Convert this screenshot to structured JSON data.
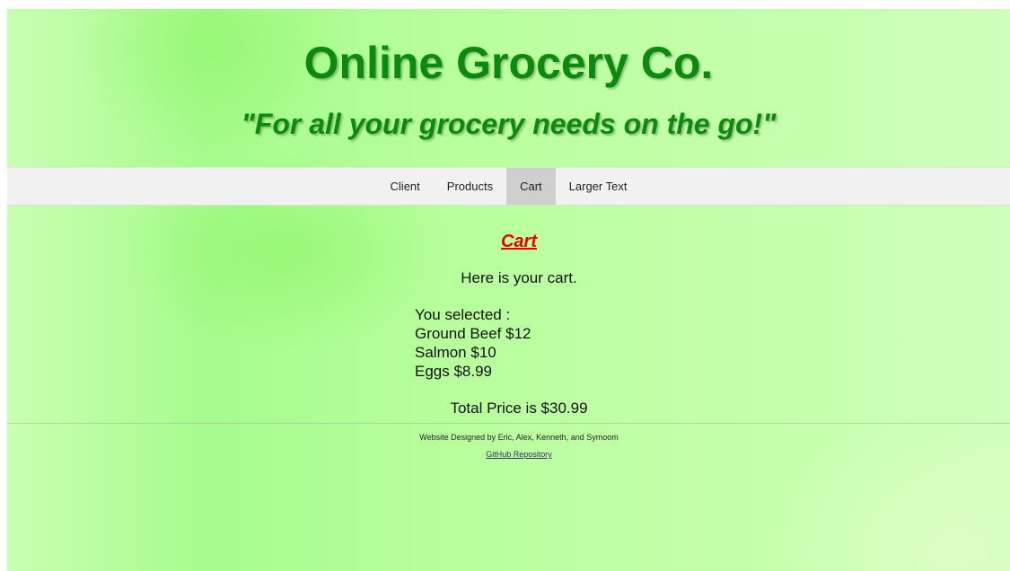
{
  "header": {
    "title": "Online Grocery Co.",
    "slogan": "\"For all your grocery needs on the go!\""
  },
  "nav": {
    "items": [
      {
        "label": "Client",
        "active": false
      },
      {
        "label": "Products",
        "active": false
      },
      {
        "label": "Cart",
        "active": true
      },
      {
        "label": "Larger Text",
        "active": false
      }
    ]
  },
  "cart": {
    "heading": "Cart",
    "intro": "Here is your cart.",
    "selected_label": "You selected :",
    "items": [
      "Ground Beef $12",
      "Salmon $10",
      "Eggs $8.99"
    ],
    "total": "Total Price is $30.99"
  },
  "footer": {
    "credit": "Website Designed by Eric, Alex, Kenneth, and Symoom",
    "link_label": "GitHub Repository"
  },
  "colors": {
    "title": "#0b8a0b",
    "cart_heading": "#e60000",
    "navbar": "#f1f1f1",
    "nav_active": "#cfcfcf"
  }
}
